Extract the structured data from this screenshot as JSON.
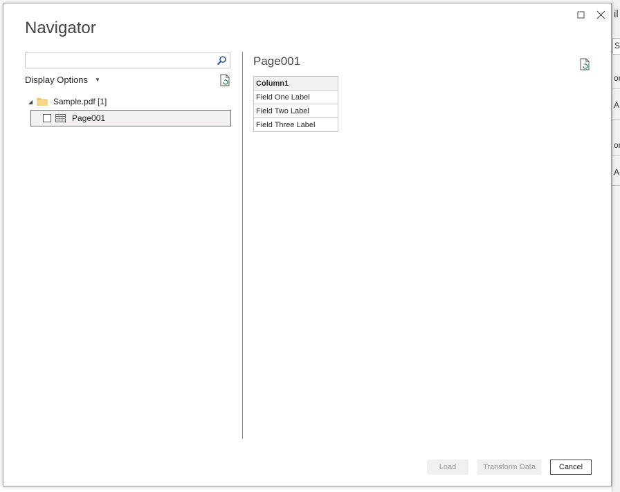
{
  "dialog": {
    "title": "Navigator",
    "maximize_icon": "maximize-icon",
    "close_icon": "close-icon"
  },
  "left_pane": {
    "search": {
      "value": "",
      "placeholder": "",
      "icon": "search-icon"
    },
    "display_options_label": "Display Options",
    "refresh_icon": "refresh-file-icon",
    "tree": {
      "folder": {
        "label": "Sample.pdf [1]",
        "expanded": true,
        "icon": "folder-icon"
      },
      "items": [
        {
          "label": "Page001",
          "checked": false,
          "selected": true,
          "icon": "table-icon"
        }
      ]
    }
  },
  "preview": {
    "title": "Page001",
    "refresh_icon": "refresh-file-icon",
    "columns": [
      "Column1"
    ],
    "rows": [
      [
        "Field One Label"
      ],
      [
        "Field Two Label"
      ],
      [
        "Field Three Label"
      ]
    ]
  },
  "footer": {
    "load_label": "Load",
    "transform_label": "Transform Data",
    "cancel_label": "Cancel"
  },
  "background_app": {
    "fragments": [
      "il",
      "Sc",
      "or",
      "A",
      "or",
      "A"
    ]
  },
  "colors": {
    "border": "#a19f9d",
    "selection_bg": "#f3f2f1",
    "disabled_button_bg": "#f0f0f0",
    "disabled_button_text": "#9a9a9a",
    "accent_blue": "#2b579a",
    "refresh_green": "#107c41"
  }
}
